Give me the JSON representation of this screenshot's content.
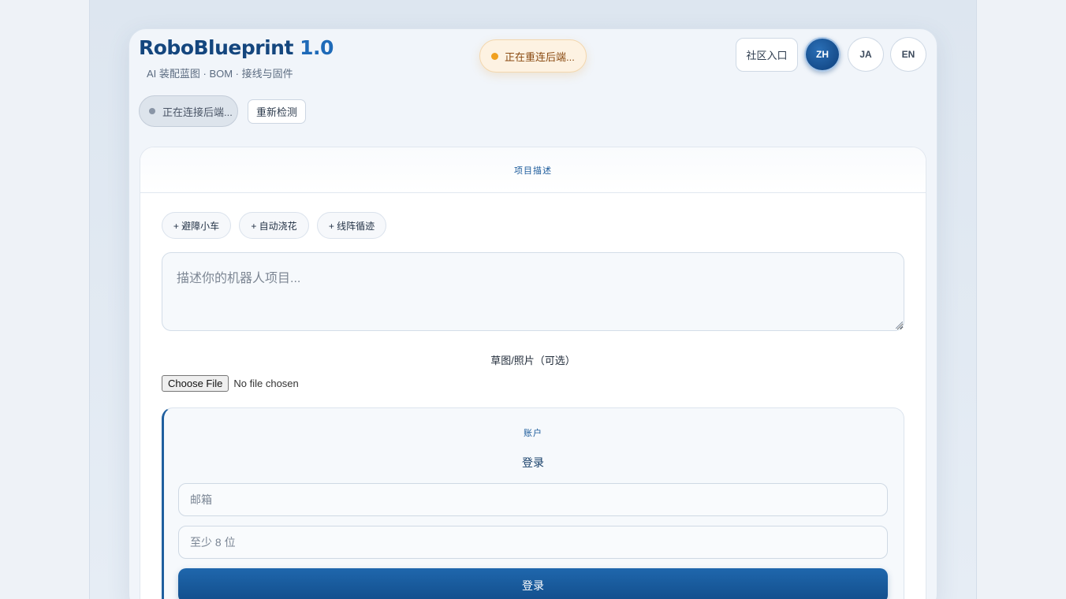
{
  "brand": {
    "name": "RoboBlueprint",
    "version": "1.0",
    "subtitle": "AI 装配蓝图 · BOM · 接线与固件"
  },
  "toast": {
    "text": "正在重连后端..."
  },
  "header": {
    "community_label": "社区入口",
    "languages": [
      {
        "code": "ZH",
        "active": true
      },
      {
        "code": "JA",
        "active": false
      },
      {
        "code": "EN",
        "active": false
      }
    ]
  },
  "connection": {
    "status_text": "正在连接后端...",
    "recheck_label": "重新检测"
  },
  "project": {
    "section_title": "项目描述",
    "chips": [
      "+ 避障小车",
      "+ 自动浇花",
      "+ 线阵循迹"
    ],
    "description_placeholder": "描述你的机器人项目...",
    "description_value": "",
    "sketch_label": "草图/照片（可选）",
    "file_button_label": "Choose File",
    "file_status": "No file chosen"
  },
  "account": {
    "section_title": "账户",
    "login_heading": "登录",
    "email_placeholder": "邮箱",
    "password_placeholder": "至少 8 位",
    "login_button_label": "登录"
  },
  "colors": {
    "accent": "#1f67ad",
    "brand": "#14467e",
    "warning": "#f0a020"
  }
}
